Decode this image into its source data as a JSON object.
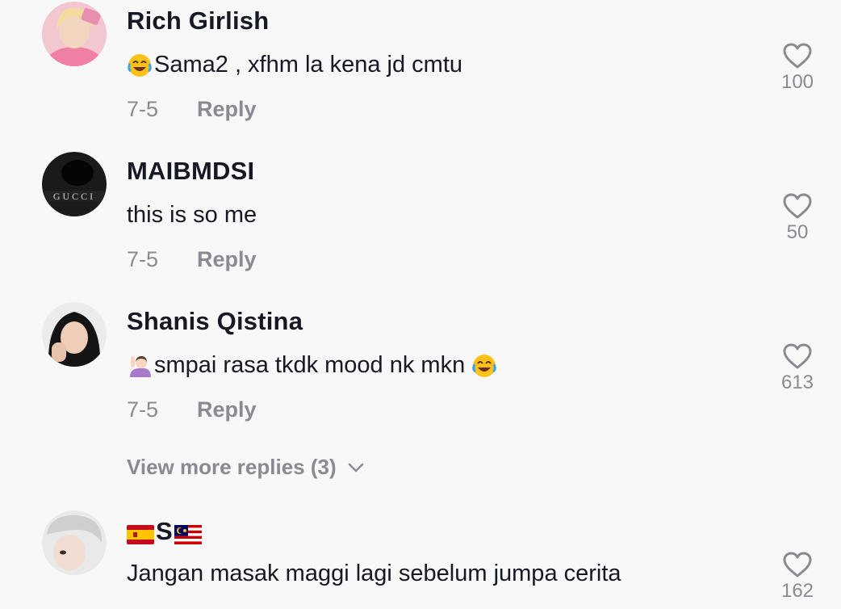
{
  "comments": [
    {
      "username": "Rich Girlish",
      "text": "Sama2 , xfhm la kena jd cmtu",
      "leading_emoji": "face-with-tears-of-joy",
      "date": "7-5",
      "reply_label": "Reply",
      "likes": "100"
    },
    {
      "username": "MAIBMDSI",
      "text": "this is so me",
      "date": "7-5",
      "reply_label": "Reply",
      "likes": "50",
      "avatar_text": "GUCCI"
    },
    {
      "username": "Shanis Qistina",
      "text": "smpai rasa tkdk mood nk mkn",
      "leading_emoji": "person-raising-hand",
      "trailing_emoji": "face-with-tears-of-joy",
      "date": "7-5",
      "reply_label": "Reply",
      "likes": "613"
    },
    {
      "username": "S",
      "username_flags": [
        "spain-flag",
        "malaysia-flag"
      ],
      "text": "Jangan masak maggi lagi sebelum jumpa cerita",
      "likes": "162"
    }
  ],
  "view_more_replies": "View more replies (3)",
  "colors": {
    "background": "#f8f8f8",
    "primary_text": "#161823",
    "secondary_text": "#8a8b91"
  }
}
